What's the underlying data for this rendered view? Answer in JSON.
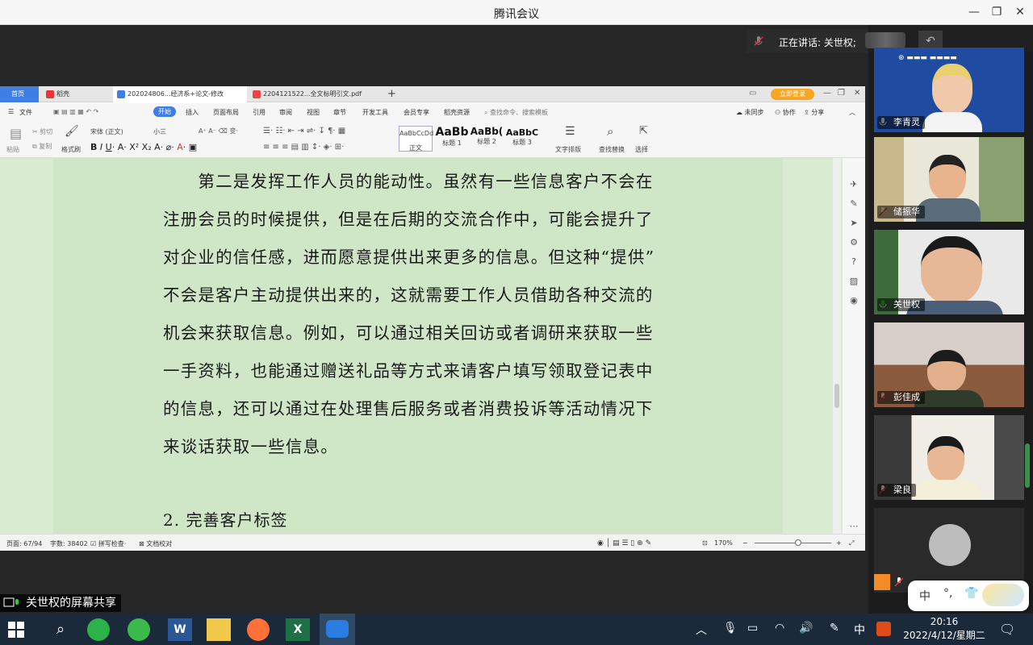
{
  "window": {
    "title": "腾讯会议"
  },
  "meeting": {
    "speaking_label": "正在讲话: 关世权;",
    "share_label": "关世权的屏幕共享"
  },
  "wps": {
    "tabs": [
      {
        "label": "首页"
      },
      {
        "label": "稻壳"
      },
      {
        "label": "202024806...经济系+论文-修改"
      },
      {
        "label": "2204121522...全文标明引文.pdf"
      }
    ],
    "login_button": "立即登录",
    "menu": {
      "file": "文件",
      "items": [
        "开始",
        "插入",
        "页面布局",
        "引用",
        "审阅",
        "视图",
        "章节",
        "开发工具",
        "会员专享",
        "稻壳资源"
      ],
      "search": "查找命令、搜索模板",
      "sync": "未同步",
      "collab": "协作",
      "share": "分享"
    },
    "ribbon": {
      "paste": "粘贴",
      "cut": "剪切",
      "copy": "复制",
      "format_painter": "格式刷",
      "font_name": "宋体 (正文)",
      "font_size": "小三",
      "styles": [
        {
          "preview": "AaBbCcDd",
          "name": "正文"
        },
        {
          "preview": "AaBb",
          "name": "标题 1"
        },
        {
          "preview": "AaBb(",
          "name": "标题 2"
        },
        {
          "preview": "AaBbC",
          "name": "标题 3"
        }
      ],
      "text_layout": "文字排版",
      "find_replace": "查找替换",
      "select": "选择"
    },
    "document": {
      "paragraph_lines": [
        "　　第二是发挥工作人员的能动性。虽然有一些信息客户不会在",
        "注册会员的时候提供，但是在后期的交流合作中，可能会提升了",
        "对企业的信任感，进而愿意提供出来更多的信息。但这种“提供”",
        "不会是客户主动提供出来的，这就需要工作人员借助各种交流的",
        "机会来获取信息。例如，可以通过相关回访或者调研来获取一些",
        "一手资料，也能通过赠送礼品等方式来请客户填写领取登记表中",
        "的信息，还可以通过在处理售后服务或者消费投诉等活动情况下",
        "来谈话获取一些信息。"
      ],
      "heading": "2. 完善客户标签"
    },
    "status": {
      "page": "页面: 67/94",
      "words": "字数: 38402",
      "spellcheck": "拼写检查",
      "proof": "文档校对",
      "zoom": "170%"
    }
  },
  "participants": [
    {
      "name": "李青灵",
      "muted": false,
      "bg": "#1f4ca0"
    },
    {
      "name": "储振华",
      "muted": true,
      "bg": "#8a8f6a"
    },
    {
      "name": "关世权",
      "muted": false,
      "bg": "#dcdcdc"
    },
    {
      "name": "彭佳成",
      "muted": true,
      "bg": "#7a5a4a"
    },
    {
      "name": "梁良",
      "muted": true,
      "bg": "#c9b9a0"
    },
    {
      "name": "",
      "muted": true,
      "bg": "#2a2a2a"
    }
  ],
  "ime": {
    "lang": "中"
  },
  "taskbar": {
    "time": "20:16",
    "date": "2022/4/12/星期二",
    "ime_indicator": "中"
  }
}
